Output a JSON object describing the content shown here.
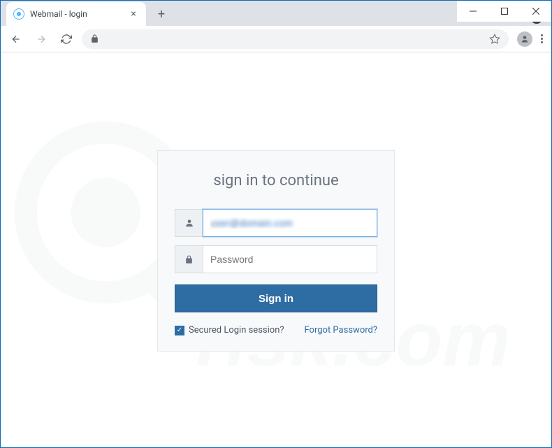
{
  "window": {
    "minimize": "–",
    "maximize": "□",
    "close": "×"
  },
  "tab": {
    "title": "Webmail - login"
  },
  "login": {
    "title": "sign in to continue",
    "username_value": "user@domain.com",
    "password_placeholder": "Password",
    "signin_label": "Sign in",
    "secured_label": "Secured Login session?",
    "forgot_label": "Forgot Password?"
  },
  "colors": {
    "primary": "#2e6da4",
    "frame": "#0a6ab6"
  }
}
